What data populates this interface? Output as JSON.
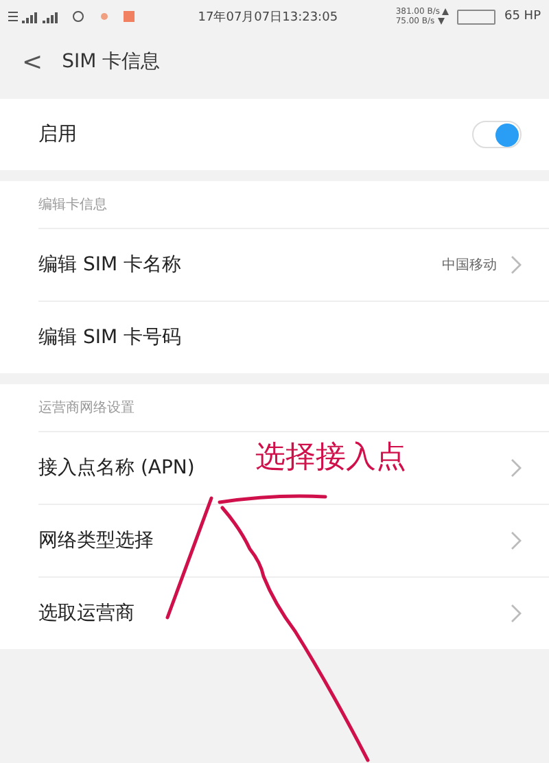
{
  "status_bar": {
    "datetime": "17年07月07日13:23:05",
    "upload_speed": "381.00 B/s",
    "download_speed": "75.00 B/s",
    "battery": "65 HP"
  },
  "header": {
    "back": "<",
    "title": "SIM 卡信息"
  },
  "enable": {
    "label": "启用",
    "on": true
  },
  "sections": [
    {
      "title": "编辑卡信息",
      "items": [
        {
          "label": "编辑 SIM 卡名称",
          "value": "中国移动",
          "chevron": true
        },
        {
          "label": "编辑 SIM 卡号码",
          "chevron": false
        }
      ]
    },
    {
      "title": "运营商网络设置",
      "items": [
        {
          "label": "接入点名称 (APN)",
          "chevron": true
        },
        {
          "label": "网络类型选择",
          "chevron": true
        },
        {
          "label": "选取运营商",
          "chevron": true
        }
      ]
    }
  ],
  "annotation": {
    "text": "选择接入点"
  }
}
